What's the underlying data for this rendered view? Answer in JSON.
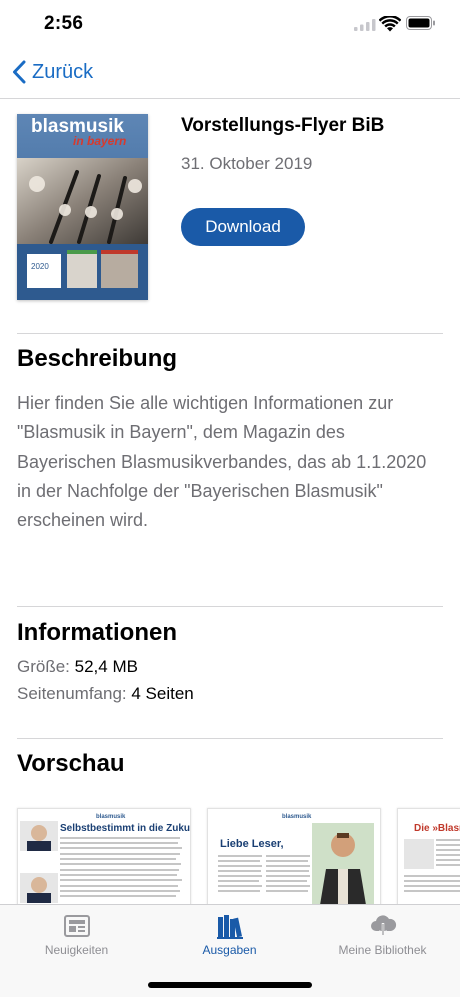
{
  "status_bar": {
    "time": "2:56"
  },
  "nav": {
    "back_label": "Zurück"
  },
  "issue": {
    "title": "Vorstellungs-Flyer BiB",
    "date": "31. Oktober 2019",
    "download_label": "Download",
    "cover": {
      "logo_main": "blasmusik",
      "logo_sub": "in bayern",
      "year": "2020"
    }
  },
  "description": {
    "heading": "Beschreibung",
    "text": "Hier finden Sie alle wichtigen Informationen zur \"Blasmusik in Bayern\", dem Magazin des Bayerischen Blasmusikverbandes, das ab 1.1.2020 in der Nachfolge der \"Bayerischen Blasmusik\" erscheinen wird."
  },
  "information": {
    "heading": "Informationen",
    "size_label": "Größe:",
    "size_value": "52,4 MB",
    "pages_label": "Seitenumfang:",
    "pages_value": "4 Seiten"
  },
  "preview": {
    "heading": "Vorschau",
    "pages": [
      {
        "headline": "Selbstbestimmt in die Zukunft"
      },
      {
        "headline": "Liebe Leser,"
      },
      {
        "headline": "Die »Blasmu"
      }
    ]
  },
  "tab_bar": {
    "tabs": [
      {
        "label": "Neuigkeiten",
        "icon": "newspaper-icon"
      },
      {
        "label": "Ausgaben",
        "icon": "books-icon",
        "active": true
      },
      {
        "label": "Meine Bibliothek",
        "icon": "cloud-download-icon"
      }
    ]
  },
  "colors": {
    "accent": "#1a5aa8",
    "link": "#1a6cc4",
    "secondary_text": "#6e6e73"
  }
}
